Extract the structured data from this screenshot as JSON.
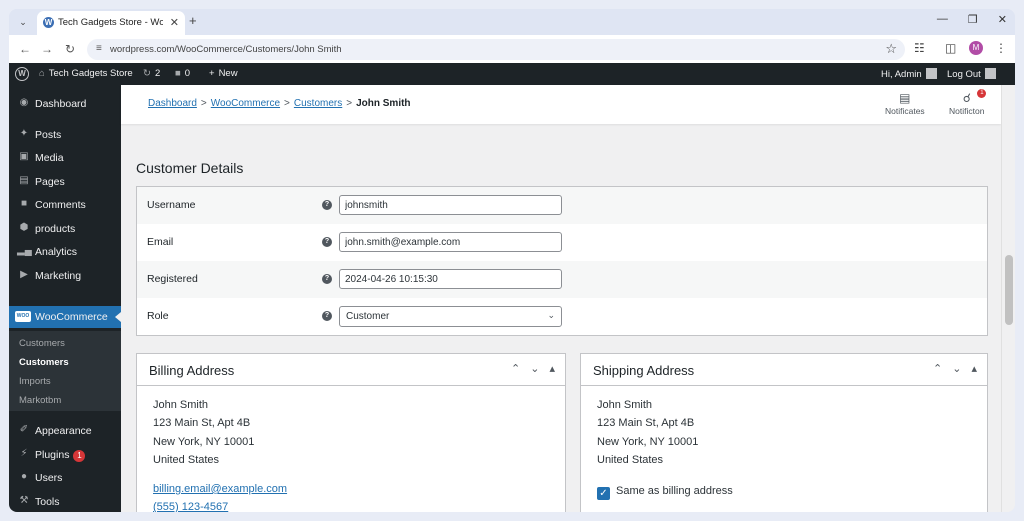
{
  "browser": {
    "tab_title": "Tech Gadgets Store - WordPress",
    "url": "wordpress.com/WooCommerce/Customers/John Smith",
    "profile_initial": "M"
  },
  "adminbar": {
    "site_name": "Tech Gadgets Store",
    "updates_count": "2",
    "comments_count": "0",
    "new_label": "New",
    "greeting": "Hi, Admin",
    "logout": "Log Out"
  },
  "sidebar": {
    "items": [
      {
        "label": "Dashboard",
        "icon": "dashboard-icon"
      },
      {
        "label": "Posts",
        "icon": "pin-icon"
      },
      {
        "label": "Media",
        "icon": "media-icon"
      },
      {
        "label": "Pages",
        "icon": "pages-icon"
      },
      {
        "label": "Comments",
        "icon": "comment-icon"
      },
      {
        "label": "products",
        "icon": "box-icon"
      },
      {
        "label": "Analytics",
        "icon": "bar-chart-icon"
      },
      {
        "label": "Marketing",
        "icon": "megaphone-icon"
      },
      {
        "label": "WooCommerce",
        "icon": "woo-icon"
      }
    ],
    "submenu": [
      "Customers",
      "Customers",
      "Imports",
      "Markotbm"
    ],
    "items_bottom": [
      {
        "label": "Appearance",
        "icon": "brush-icon"
      },
      {
        "label": "Plugins",
        "icon": "plug-icon",
        "badge": "1"
      },
      {
        "label": "Users",
        "icon": "user-icon"
      },
      {
        "label": "Tools",
        "icon": "wrench-icon"
      }
    ]
  },
  "breadcrumb": {
    "items": [
      "Dashboard",
      "WooCommerce",
      "Customers"
    ],
    "current": "John Smith",
    "separator": ">"
  },
  "top_actions": {
    "notificates": "Notificates",
    "notificton": "Notificton",
    "notif_count": "1"
  },
  "page_title": "Customer Details",
  "form": {
    "username_label": "Username",
    "username_value": "johnsmith",
    "email_label": "Email",
    "email_value": "john.smith@example.com",
    "registered_label": "Registered",
    "registered_value": "2024-04-26 10:15:30",
    "role_label": "Role",
    "role_value": "Customer",
    "help_glyph": "?"
  },
  "billing": {
    "title": "Billing Address",
    "name": "John Smith",
    "street": "123 Main St, Apt 4B",
    "city": "New York, NY 10001",
    "country": "United States",
    "email": "billing.email@example.com",
    "phone": "(555) 123-4567"
  },
  "shipping": {
    "title": "Shipping Address",
    "name": "John Smith",
    "street": "123 Main St, Apt 4B",
    "city": "New York, NY 10001",
    "country": "United States",
    "same_as_billing": "Same as billing address",
    "same_checked": true
  },
  "colors": {
    "accent": "#2271b1",
    "admin_dark": "#1d2327",
    "badge_red": "#d63638"
  }
}
